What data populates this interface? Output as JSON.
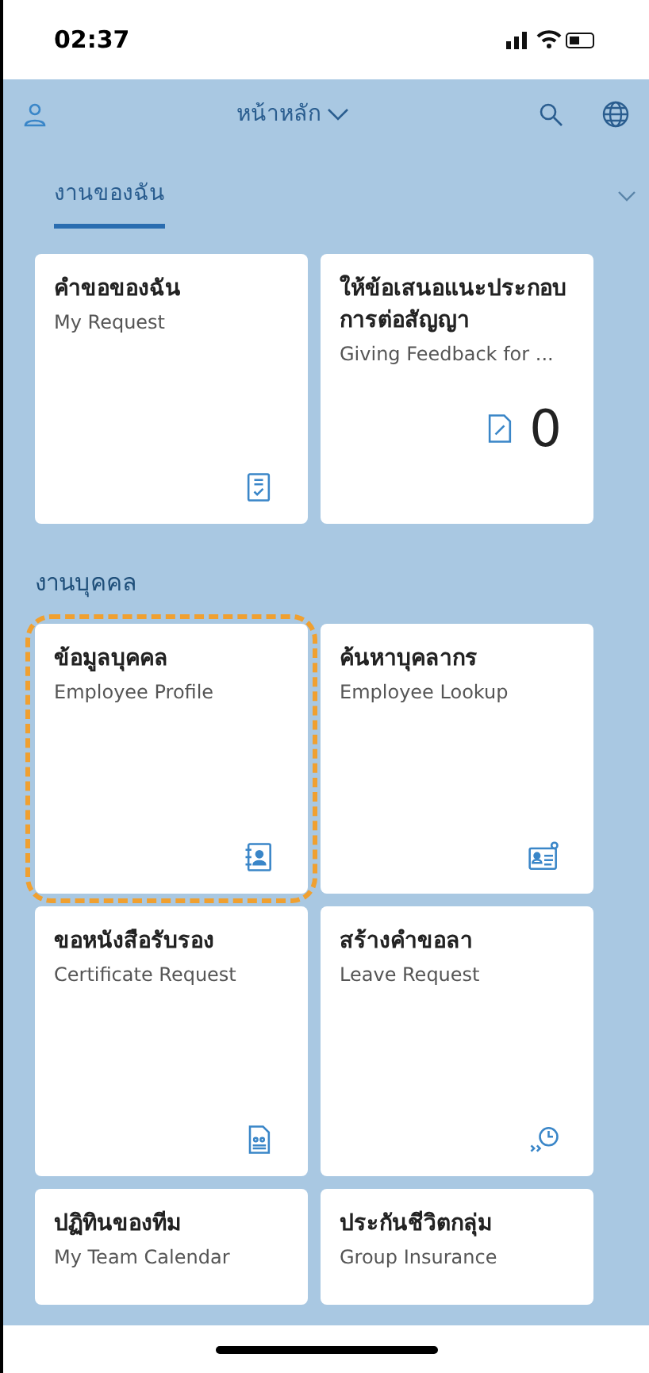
{
  "status_bar": {
    "time": "02:37"
  },
  "header": {
    "title": "หน้าหลัก"
  },
  "tabs": [
    {
      "label": "งานของฉัน",
      "selected": true
    }
  ],
  "groups": [
    {
      "tiles": [
        {
          "title": "คำขอของฉัน",
          "subtitle": "My Request",
          "kind": "icon",
          "highlighted": false
        },
        {
          "title": "ให้ข้อเสนอแนะประกอบการต่อสัญญา",
          "subtitle": "Giving Feedback for ...",
          "kind": "counter",
          "count": "0",
          "highlighted": false
        }
      ]
    },
    {
      "title": "งานบุคคล",
      "tiles": [
        {
          "title": "ข้อมูลบุคคล",
          "subtitle": "Employee Profile",
          "kind": "icon",
          "highlighted": true
        },
        {
          "title": "ค้นหาบุคลากร",
          "subtitle": "Employee Lookup",
          "kind": "icon",
          "highlighted": false
        },
        {
          "title": "ขอหนังสือรับรอง",
          "subtitle": "Certificate Request",
          "kind": "icon",
          "highlighted": false
        },
        {
          "title": "สร้างคำขอลา",
          "subtitle": "Leave Request",
          "kind": "icon",
          "highlighted": false
        },
        {
          "title": "ปฏิทินของทีม",
          "subtitle": "My Team Calendar",
          "kind": "partial",
          "highlighted": false
        },
        {
          "title": "ประกันชีวิตกลุ่ม",
          "subtitle": "Group Insurance",
          "kind": "partial",
          "highlighted": false
        }
      ]
    }
  ]
}
